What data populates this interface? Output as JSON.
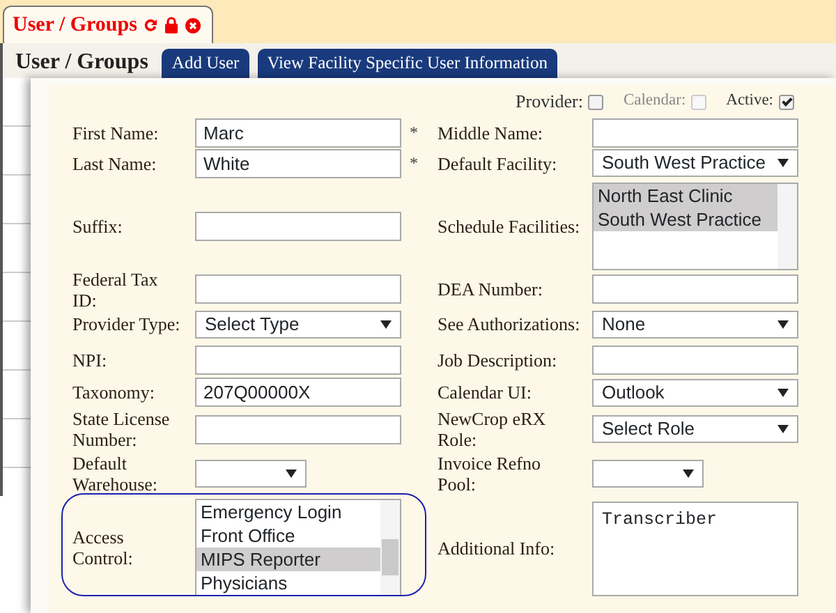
{
  "tab": {
    "title": "User / Groups",
    "selected": true
  },
  "heading": "User / Groups",
  "buttons": [
    "Add User",
    "View Facility Specific User Information"
  ],
  "flags": [
    {
      "label": "Provider:",
      "checked": false,
      "disabled": false
    },
    {
      "label": "Calendar:",
      "checked": false,
      "disabled": true
    },
    {
      "label": "Active:",
      "checked": true,
      "disabled": false
    }
  ],
  "rows": [
    {
      "left": {
        "label": "First Name:",
        "kind": "text",
        "value": "Marc",
        "required_mark": "*"
      },
      "right": {
        "label": "Middle Name:",
        "kind": "text"
      }
    },
    {
      "left": {
        "label": "Last Name:",
        "kind": "text",
        "value": "White",
        "required_mark": "*"
      },
      "right": {
        "label": "Default Facility:",
        "kind": "select",
        "value": "South West Practice"
      }
    },
    {
      "left": {
        "label": "Suffix:",
        "kind": "text"
      },
      "right": {
        "label": "Schedule Facilities:",
        "kind": "listbox",
        "options": [
          {
            "label": "North East Clinic",
            "selected": true
          },
          {
            "label": "South West Practice",
            "selected": true
          }
        ]
      }
    },
    {
      "left": {
        "label": "Federal Tax ID:",
        "kind": "text"
      },
      "right": {
        "label": "DEA Number:",
        "kind": "text"
      }
    },
    {
      "left": {
        "label": "Provider Type:",
        "kind": "select",
        "value": "Select Type"
      },
      "right": {
        "label": "See Authorizations:",
        "kind": "select",
        "value": "None"
      }
    },
    {
      "left": {
        "label": "NPI:",
        "kind": "text"
      },
      "right": {
        "label": "Job Description:",
        "kind": "text"
      }
    },
    {
      "left": {
        "label": "Taxonomy:",
        "kind": "text",
        "value": "207Q00000X"
      },
      "right": {
        "label": "Calendar UI:",
        "kind": "select",
        "value": "Outlook"
      }
    },
    {
      "left": {
        "label": "State License Number:",
        "kind": "text"
      },
      "right": {
        "label": "NewCrop eRX Role:",
        "kind": "select",
        "value": "Select Role"
      }
    },
    {
      "left": {
        "label": "Default Warehouse:",
        "kind": "smallselect"
      },
      "right": {
        "label": "Invoice Refno Pool:",
        "kind": "smallselect"
      }
    },
    {
      "left": {
        "label": "Access Control:",
        "kind": "listbox",
        "highlighted": true,
        "options": [
          {
            "label": "Emergency Login",
            "selected": false
          },
          {
            "label": "Front Office",
            "selected": false
          },
          {
            "label": "MIPS Reporter",
            "selected": true
          },
          {
            "label": "Physicians",
            "selected": false
          }
        ]
      },
      "right": {
        "label": "Additional Info:",
        "kind": "textarea",
        "value": "Transcriber"
      }
    }
  ]
}
